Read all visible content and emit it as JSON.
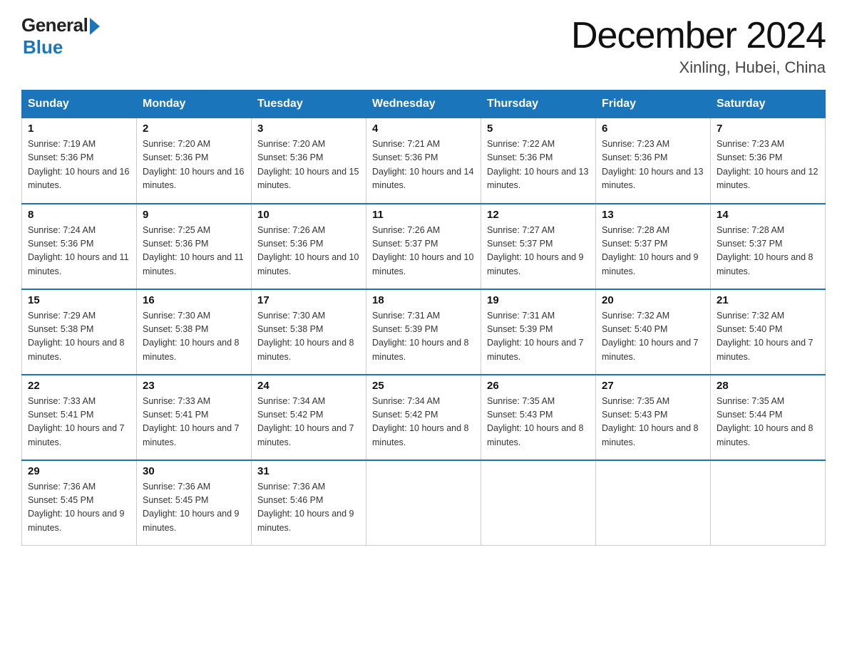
{
  "header": {
    "logo_general": "General",
    "logo_blue": "Blue",
    "month_title": "December 2024",
    "location": "Xinling, Hubei, China"
  },
  "days_of_week": [
    "Sunday",
    "Monday",
    "Tuesday",
    "Wednesday",
    "Thursday",
    "Friday",
    "Saturday"
  ],
  "weeks": [
    [
      {
        "day": "1",
        "sunrise": "7:19 AM",
        "sunset": "5:36 PM",
        "daylight": "10 hours and 16 minutes."
      },
      {
        "day": "2",
        "sunrise": "7:20 AM",
        "sunset": "5:36 PM",
        "daylight": "10 hours and 16 minutes."
      },
      {
        "day": "3",
        "sunrise": "7:20 AM",
        "sunset": "5:36 PM",
        "daylight": "10 hours and 15 minutes."
      },
      {
        "day": "4",
        "sunrise": "7:21 AM",
        "sunset": "5:36 PM",
        "daylight": "10 hours and 14 minutes."
      },
      {
        "day": "5",
        "sunrise": "7:22 AM",
        "sunset": "5:36 PM",
        "daylight": "10 hours and 13 minutes."
      },
      {
        "day": "6",
        "sunrise": "7:23 AM",
        "sunset": "5:36 PM",
        "daylight": "10 hours and 13 minutes."
      },
      {
        "day": "7",
        "sunrise": "7:23 AM",
        "sunset": "5:36 PM",
        "daylight": "10 hours and 12 minutes."
      }
    ],
    [
      {
        "day": "8",
        "sunrise": "7:24 AM",
        "sunset": "5:36 PM",
        "daylight": "10 hours and 11 minutes."
      },
      {
        "day": "9",
        "sunrise": "7:25 AM",
        "sunset": "5:36 PM",
        "daylight": "10 hours and 11 minutes."
      },
      {
        "day": "10",
        "sunrise": "7:26 AM",
        "sunset": "5:36 PM",
        "daylight": "10 hours and 10 minutes."
      },
      {
        "day": "11",
        "sunrise": "7:26 AM",
        "sunset": "5:37 PM",
        "daylight": "10 hours and 10 minutes."
      },
      {
        "day": "12",
        "sunrise": "7:27 AM",
        "sunset": "5:37 PM",
        "daylight": "10 hours and 9 minutes."
      },
      {
        "day": "13",
        "sunrise": "7:28 AM",
        "sunset": "5:37 PM",
        "daylight": "10 hours and 9 minutes."
      },
      {
        "day": "14",
        "sunrise": "7:28 AM",
        "sunset": "5:37 PM",
        "daylight": "10 hours and 8 minutes."
      }
    ],
    [
      {
        "day": "15",
        "sunrise": "7:29 AM",
        "sunset": "5:38 PM",
        "daylight": "10 hours and 8 minutes."
      },
      {
        "day": "16",
        "sunrise": "7:30 AM",
        "sunset": "5:38 PM",
        "daylight": "10 hours and 8 minutes."
      },
      {
        "day": "17",
        "sunrise": "7:30 AM",
        "sunset": "5:38 PM",
        "daylight": "10 hours and 8 minutes."
      },
      {
        "day": "18",
        "sunrise": "7:31 AM",
        "sunset": "5:39 PM",
        "daylight": "10 hours and 8 minutes."
      },
      {
        "day": "19",
        "sunrise": "7:31 AM",
        "sunset": "5:39 PM",
        "daylight": "10 hours and 7 minutes."
      },
      {
        "day": "20",
        "sunrise": "7:32 AM",
        "sunset": "5:40 PM",
        "daylight": "10 hours and 7 minutes."
      },
      {
        "day": "21",
        "sunrise": "7:32 AM",
        "sunset": "5:40 PM",
        "daylight": "10 hours and 7 minutes."
      }
    ],
    [
      {
        "day": "22",
        "sunrise": "7:33 AM",
        "sunset": "5:41 PM",
        "daylight": "10 hours and 7 minutes."
      },
      {
        "day": "23",
        "sunrise": "7:33 AM",
        "sunset": "5:41 PM",
        "daylight": "10 hours and 7 minutes."
      },
      {
        "day": "24",
        "sunrise": "7:34 AM",
        "sunset": "5:42 PM",
        "daylight": "10 hours and 7 minutes."
      },
      {
        "day": "25",
        "sunrise": "7:34 AM",
        "sunset": "5:42 PM",
        "daylight": "10 hours and 8 minutes."
      },
      {
        "day": "26",
        "sunrise": "7:35 AM",
        "sunset": "5:43 PM",
        "daylight": "10 hours and 8 minutes."
      },
      {
        "day": "27",
        "sunrise": "7:35 AM",
        "sunset": "5:43 PM",
        "daylight": "10 hours and 8 minutes."
      },
      {
        "day": "28",
        "sunrise": "7:35 AM",
        "sunset": "5:44 PM",
        "daylight": "10 hours and 8 minutes."
      }
    ],
    [
      {
        "day": "29",
        "sunrise": "7:36 AM",
        "sunset": "5:45 PM",
        "daylight": "10 hours and 9 minutes."
      },
      {
        "day": "30",
        "sunrise": "7:36 AM",
        "sunset": "5:45 PM",
        "daylight": "10 hours and 9 minutes."
      },
      {
        "day": "31",
        "sunrise": "7:36 AM",
        "sunset": "5:46 PM",
        "daylight": "10 hours and 9 minutes."
      },
      null,
      null,
      null,
      null
    ]
  ]
}
